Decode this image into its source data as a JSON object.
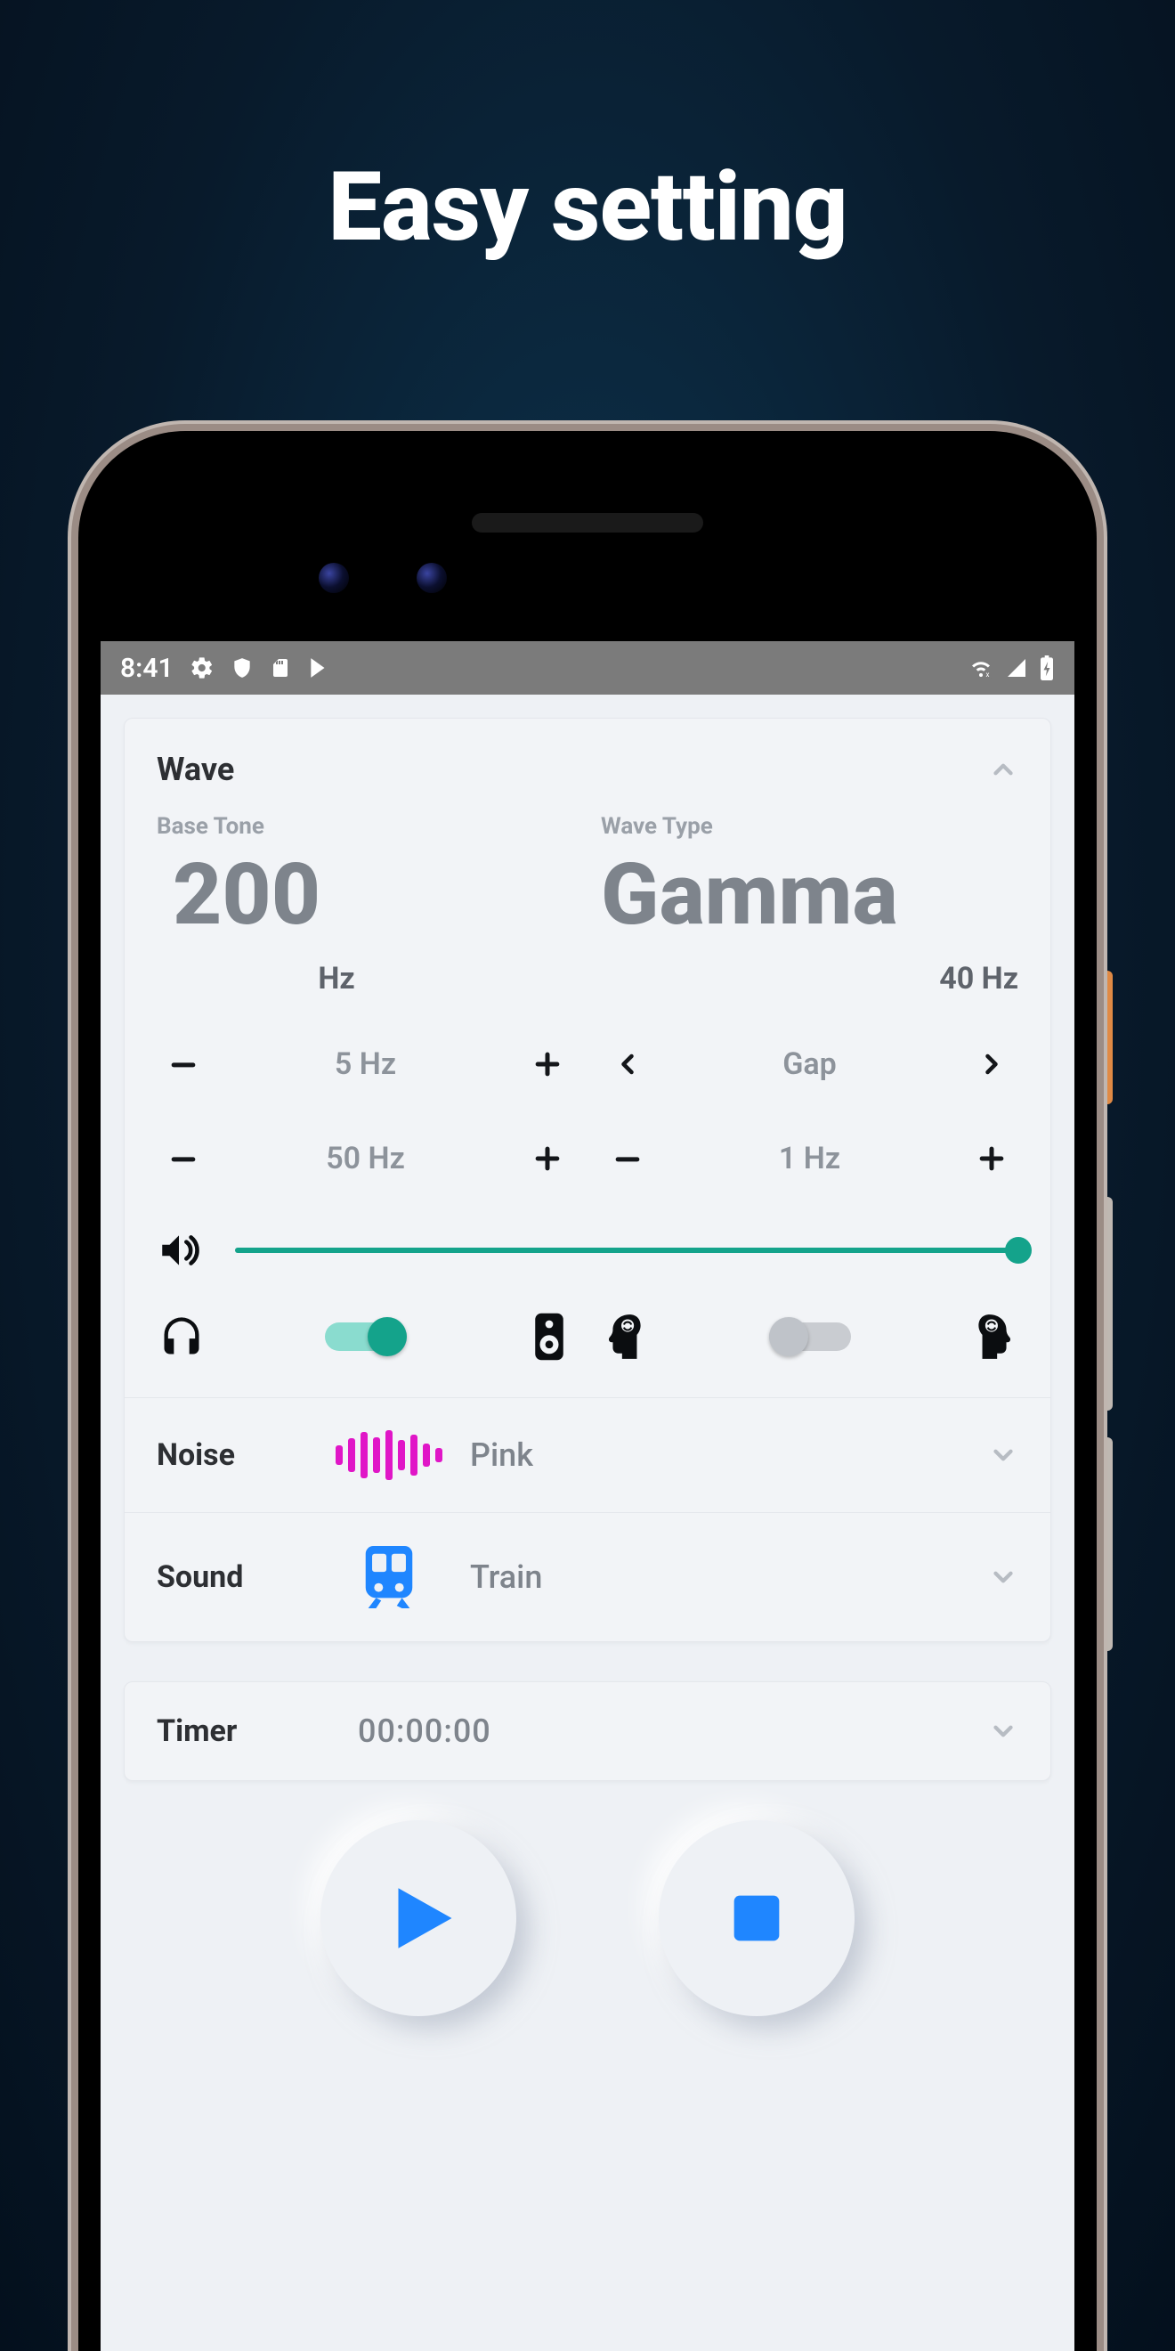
{
  "headline": "Easy setting",
  "statusbar": {
    "time": "8:41"
  },
  "wave": {
    "title": "Wave",
    "base_tone_label": "Base Tone",
    "base_tone_value": "200",
    "base_tone_unit_centered": "Hz",
    "wave_type_label": "Wave Type",
    "wave_type_value": "Gamma",
    "wave_type_freq_right": "40 Hz",
    "stepper1_left": "5 Hz",
    "stepper1_right_label": "Gap",
    "stepper2_left": "50 Hz",
    "stepper2_right": "1 Hz",
    "volume_percent": 100,
    "headphone_toggle_on": true,
    "brain_toggle_on": false
  },
  "noise": {
    "label": "Noise",
    "value": "Pink"
  },
  "sound": {
    "label": "Sound",
    "value": "Train"
  },
  "timer": {
    "label": "Timer",
    "value": "00:00:00"
  },
  "colors": {
    "accent": "#14a38b",
    "blue": "#1f86ff",
    "pink": "#e016c7"
  }
}
